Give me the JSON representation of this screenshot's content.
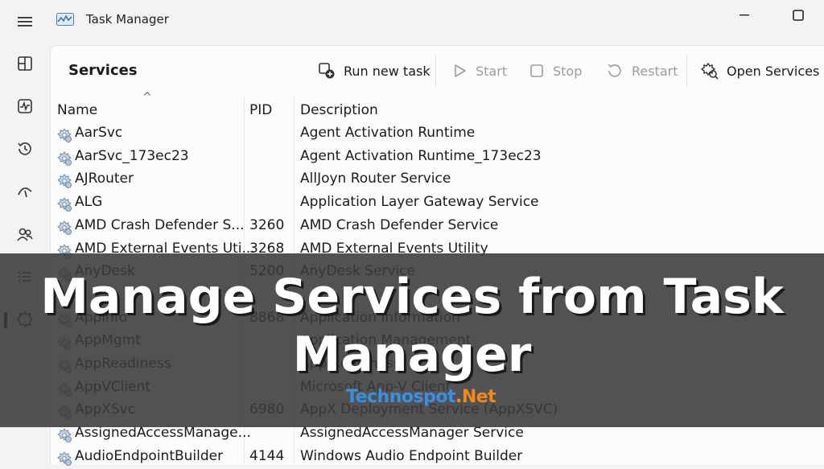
{
  "window": {
    "title": "Task Manager"
  },
  "nav": {
    "items": [
      {
        "icon": "processes-icon"
      },
      {
        "icon": "performance-icon"
      },
      {
        "icon": "app-history-icon"
      },
      {
        "icon": "startup-apps-icon"
      },
      {
        "icon": "users-icon"
      },
      {
        "icon": "details-icon"
      },
      {
        "icon": "services-icon"
      }
    ],
    "active": "services"
  },
  "toolbar": {
    "page_title": "Services",
    "run_new_task": "Run new task",
    "start": "Start",
    "stop": "Stop",
    "restart": "Restart",
    "open_services": "Open Services"
  },
  "table": {
    "headers": {
      "name": "Name",
      "pid": "PID",
      "description": "Description"
    },
    "sort_indicator": "^",
    "rows": [
      {
        "name": "AarSvc",
        "pid": "",
        "description": "Agent Activation Runtime"
      },
      {
        "name": "AarSvc_173ec23",
        "pid": "",
        "description": "Agent Activation Runtime_173ec23"
      },
      {
        "name": "AJRouter",
        "pid": "",
        "description": "AllJoyn Router Service"
      },
      {
        "name": "ALG",
        "pid": "",
        "description": "Application Layer Gateway Service"
      },
      {
        "name": "AMD Crash Defender S...",
        "pid": "3260",
        "description": "AMD Crash Defender Service"
      },
      {
        "name": "AMD External Events Uti...",
        "pid": "3268",
        "description": "AMD External Events Utility"
      },
      {
        "name": "AnyDesk",
        "pid": "5200",
        "description": "AnyDesk Service"
      },
      {
        "name": "",
        "pid": "",
        "description": ""
      },
      {
        "name": "Appinfo",
        "pid": "8868",
        "description": "Application Information"
      },
      {
        "name": "AppMgmt",
        "pid": "",
        "description": "Application Management"
      },
      {
        "name": "AppReadiness",
        "pid": "",
        "description": "App Readiness"
      },
      {
        "name": "AppVClient",
        "pid": "",
        "description": "Microsoft App-V Client"
      },
      {
        "name": "AppXSvc",
        "pid": "6980",
        "description": "AppX Deployment Service (AppXSVC)"
      },
      {
        "name": "AssignedAccessManage...",
        "pid": "",
        "description": "AssignedAccessManager Service"
      },
      {
        "name": "AudioEndpointBuilder",
        "pid": "4144",
        "description": "Windows Audio Endpoint Builder"
      }
    ]
  },
  "overlay": {
    "line1": "Manage Services from Task",
    "line2": "Manager",
    "watermark_a": "Technospot",
    "watermark_b": ".Net"
  },
  "colors": {
    "banner": "#3a3a3a",
    "watermark_blue": "#3b8fe0",
    "watermark_orange": "#f08a1a"
  }
}
